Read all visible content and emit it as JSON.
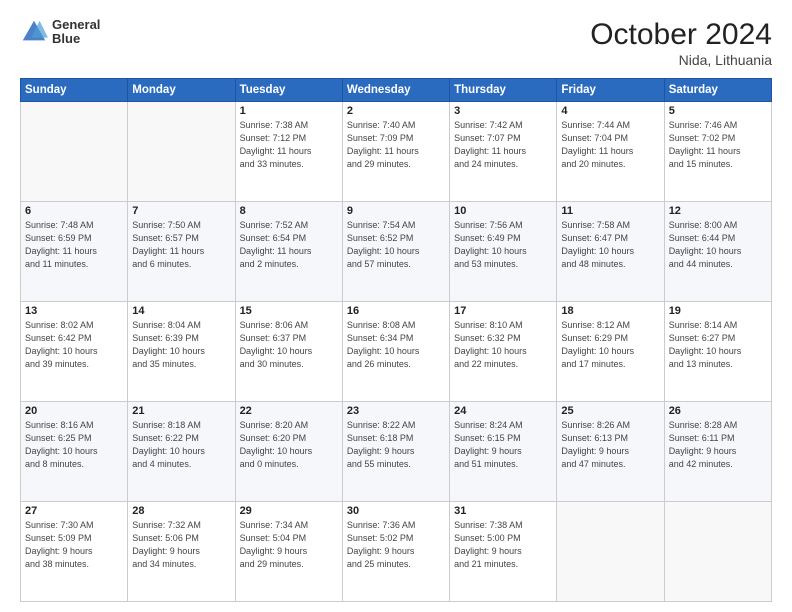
{
  "header": {
    "logo_line1": "General",
    "logo_line2": "Blue",
    "title": "October 2024",
    "subtitle": "Nida, Lithuania"
  },
  "weekdays": [
    "Sunday",
    "Monday",
    "Tuesday",
    "Wednesday",
    "Thursday",
    "Friday",
    "Saturday"
  ],
  "weeks": [
    [
      {
        "day": "",
        "info": ""
      },
      {
        "day": "",
        "info": ""
      },
      {
        "day": "1",
        "info": "Sunrise: 7:38 AM\nSunset: 7:12 PM\nDaylight: 11 hours\nand 33 minutes."
      },
      {
        "day": "2",
        "info": "Sunrise: 7:40 AM\nSunset: 7:09 PM\nDaylight: 11 hours\nand 29 minutes."
      },
      {
        "day": "3",
        "info": "Sunrise: 7:42 AM\nSunset: 7:07 PM\nDaylight: 11 hours\nand 24 minutes."
      },
      {
        "day": "4",
        "info": "Sunrise: 7:44 AM\nSunset: 7:04 PM\nDaylight: 11 hours\nand 20 minutes."
      },
      {
        "day": "5",
        "info": "Sunrise: 7:46 AM\nSunset: 7:02 PM\nDaylight: 11 hours\nand 15 minutes."
      }
    ],
    [
      {
        "day": "6",
        "info": "Sunrise: 7:48 AM\nSunset: 6:59 PM\nDaylight: 11 hours\nand 11 minutes."
      },
      {
        "day": "7",
        "info": "Sunrise: 7:50 AM\nSunset: 6:57 PM\nDaylight: 11 hours\nand 6 minutes."
      },
      {
        "day": "8",
        "info": "Sunrise: 7:52 AM\nSunset: 6:54 PM\nDaylight: 11 hours\nand 2 minutes."
      },
      {
        "day": "9",
        "info": "Sunrise: 7:54 AM\nSunset: 6:52 PM\nDaylight: 10 hours\nand 57 minutes."
      },
      {
        "day": "10",
        "info": "Sunrise: 7:56 AM\nSunset: 6:49 PM\nDaylight: 10 hours\nand 53 minutes."
      },
      {
        "day": "11",
        "info": "Sunrise: 7:58 AM\nSunset: 6:47 PM\nDaylight: 10 hours\nand 48 minutes."
      },
      {
        "day": "12",
        "info": "Sunrise: 8:00 AM\nSunset: 6:44 PM\nDaylight: 10 hours\nand 44 minutes."
      }
    ],
    [
      {
        "day": "13",
        "info": "Sunrise: 8:02 AM\nSunset: 6:42 PM\nDaylight: 10 hours\nand 39 minutes."
      },
      {
        "day": "14",
        "info": "Sunrise: 8:04 AM\nSunset: 6:39 PM\nDaylight: 10 hours\nand 35 minutes."
      },
      {
        "day": "15",
        "info": "Sunrise: 8:06 AM\nSunset: 6:37 PM\nDaylight: 10 hours\nand 30 minutes."
      },
      {
        "day": "16",
        "info": "Sunrise: 8:08 AM\nSunset: 6:34 PM\nDaylight: 10 hours\nand 26 minutes."
      },
      {
        "day": "17",
        "info": "Sunrise: 8:10 AM\nSunset: 6:32 PM\nDaylight: 10 hours\nand 22 minutes."
      },
      {
        "day": "18",
        "info": "Sunrise: 8:12 AM\nSunset: 6:29 PM\nDaylight: 10 hours\nand 17 minutes."
      },
      {
        "day": "19",
        "info": "Sunrise: 8:14 AM\nSunset: 6:27 PM\nDaylight: 10 hours\nand 13 minutes."
      }
    ],
    [
      {
        "day": "20",
        "info": "Sunrise: 8:16 AM\nSunset: 6:25 PM\nDaylight: 10 hours\nand 8 minutes."
      },
      {
        "day": "21",
        "info": "Sunrise: 8:18 AM\nSunset: 6:22 PM\nDaylight: 10 hours\nand 4 minutes."
      },
      {
        "day": "22",
        "info": "Sunrise: 8:20 AM\nSunset: 6:20 PM\nDaylight: 10 hours\nand 0 minutes."
      },
      {
        "day": "23",
        "info": "Sunrise: 8:22 AM\nSunset: 6:18 PM\nDaylight: 9 hours\nand 55 minutes."
      },
      {
        "day": "24",
        "info": "Sunrise: 8:24 AM\nSunset: 6:15 PM\nDaylight: 9 hours\nand 51 minutes."
      },
      {
        "day": "25",
        "info": "Sunrise: 8:26 AM\nSunset: 6:13 PM\nDaylight: 9 hours\nand 47 minutes."
      },
      {
        "day": "26",
        "info": "Sunrise: 8:28 AM\nSunset: 6:11 PM\nDaylight: 9 hours\nand 42 minutes."
      }
    ],
    [
      {
        "day": "27",
        "info": "Sunrise: 7:30 AM\nSunset: 5:09 PM\nDaylight: 9 hours\nand 38 minutes."
      },
      {
        "day": "28",
        "info": "Sunrise: 7:32 AM\nSunset: 5:06 PM\nDaylight: 9 hours\nand 34 minutes."
      },
      {
        "day": "29",
        "info": "Sunrise: 7:34 AM\nSunset: 5:04 PM\nDaylight: 9 hours\nand 29 minutes."
      },
      {
        "day": "30",
        "info": "Sunrise: 7:36 AM\nSunset: 5:02 PM\nDaylight: 9 hours\nand 25 minutes."
      },
      {
        "day": "31",
        "info": "Sunrise: 7:38 AM\nSunset: 5:00 PM\nDaylight: 9 hours\nand 21 minutes."
      },
      {
        "day": "",
        "info": ""
      },
      {
        "day": "",
        "info": ""
      }
    ]
  ]
}
